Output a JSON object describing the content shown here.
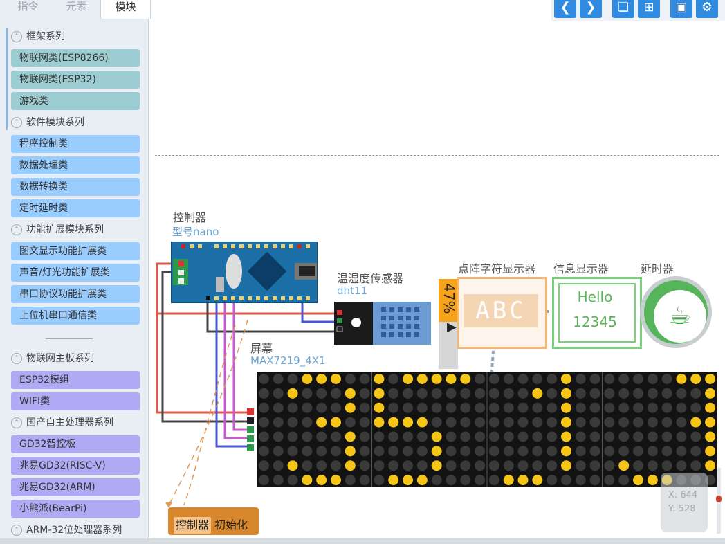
{
  "tabs": [
    {
      "label": "指令"
    },
    {
      "label": "元素"
    },
    {
      "label": "模块"
    }
  ],
  "categories": {
    "framework": {
      "label": "框架系列",
      "items": [
        "物联网类(ESP8266)",
        "物联网类(ESP32)",
        "游戏类"
      ]
    },
    "software": {
      "label": "软件模块系列",
      "items": [
        "程序控制类",
        "数据处理类",
        "数据转换类",
        "定时延时类"
      ]
    },
    "extension": {
      "label": "功能扩展模块系列",
      "items": [
        "图文显示功能扩展类",
        "声音/灯光功能扩展类",
        "串口协议功能扩展类",
        "上位机串口通信类"
      ]
    },
    "iot_board": {
      "label": "物联网主板系列",
      "items": [
        "ESP32模组",
        "WIFI类"
      ]
    },
    "domestic": {
      "label": "国产自主处理器系列",
      "items": [
        "GD32智控板",
        "兆易GD32(RISC-V)",
        "兆易GD32(ARM)",
        "小熊派(BearPi)"
      ]
    },
    "arm32": {
      "label": "ARM-32位处理器系列"
    }
  },
  "canvas": {
    "controller_label": "控制器",
    "controller_model": "型号nano",
    "sensor_label": "温湿度传感器",
    "sensor_model": "dht11",
    "screen_label": "屏幕",
    "screen_model": "MAX7219_4X1",
    "dotmatrix_label": "点阵字符显示器",
    "dotmatrix_text": "ABC",
    "infodisp_label": "信息显示器",
    "infodisp_line1": "Hello",
    "infodisp_line2": "12345",
    "timer_label": "延时器",
    "percent_text": "47%",
    "init_block_ctrl": "控制器",
    "init_block_text": "初始化",
    "coord_x": "X: 644",
    "coord_y": "Y: 528"
  },
  "colors": {
    "teal": "#9ccdd2",
    "blue": "#99ccff",
    "purple": "#aeaaf4",
    "accent": "#2f8ae0",
    "led_on": "#f5c518",
    "led_off": "#3a3a3a",
    "wire_red": "#e05a4a",
    "wire_black": "#444444",
    "wire_blue": "#4a56d8",
    "wire_purple": "#c65ad0",
    "wire_dashed": "#e39a5a"
  },
  "icons": [
    "collapse-icon",
    "chevron-left-icon",
    "chevron-right-icon",
    "copy-icon",
    "add-icon",
    "zoom-fit-icon",
    "settings-icon",
    "trash-icon",
    "teacup-icon",
    "cursor-icon"
  ]
}
